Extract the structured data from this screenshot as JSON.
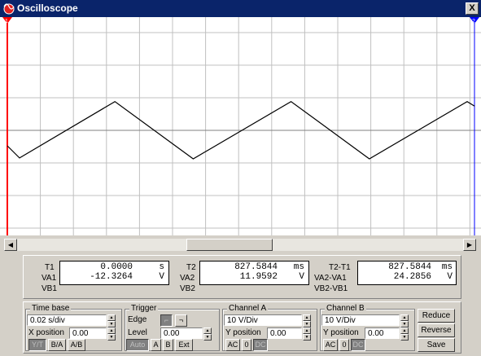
{
  "window": {
    "title": "Oscilloscope",
    "close_label": "X"
  },
  "markers": {
    "t1_label": "1",
    "t2_label": "2"
  },
  "readouts": {
    "t1": {
      "label": "T1",
      "value": "0.0000",
      "unit": "s",
      "va_label": "VA1",
      "va_value": "-12.3264",
      "va_unit": "V",
      "vb_label": "VB1"
    },
    "t2": {
      "label": "T2",
      "value": "827.5844",
      "unit": "ms",
      "va_label": "VA2",
      "va_value": "11.9592",
      "va_unit": "V",
      "vb_label": "VB2"
    },
    "diff": {
      "label": "T2-T1",
      "value": "827.5844",
      "unit": "ms",
      "va_label": "VA2-VA1",
      "va_value": "24.2856",
      "va_unit": "V",
      "vb_label": "VB2-VB1"
    }
  },
  "timebase": {
    "title": "Time base",
    "value": "0.02 s/div",
    "xpos_label": "X position",
    "xpos_value": "0.00",
    "buttons": [
      "Y/T",
      "B/A",
      "A/B"
    ]
  },
  "trigger": {
    "title": "Trigger",
    "edge_label": "Edge",
    "level_label": "Level",
    "level_value": "0.00",
    "buttons": [
      "Auto",
      "A",
      "B",
      "Ext"
    ]
  },
  "channel_a": {
    "title": "Channel A",
    "value": "10 V/Div",
    "ypos_label": "Y position",
    "ypos_value": "0.00",
    "buttons": [
      "AC",
      "0",
      "DC"
    ]
  },
  "channel_b": {
    "title": "Channel B",
    "value": "10 V/Div",
    "ypos_label": "Y position",
    "ypos_value": "0.00",
    "buttons": [
      "AC",
      "0",
      "DC"
    ]
  },
  "actions": {
    "reduce": "Reduce",
    "reverse": "Reverse",
    "save": "Save"
  },
  "colors": {
    "title_bar": "#0a246a",
    "trace": "#000000",
    "grid": "#c0c0c0",
    "cursor1": "#ff0000",
    "cursor2": "#0000ff"
  },
  "waveform": {
    "type": "triangle",
    "peaks_volts": 12,
    "div_volts": 10,
    "sample_points": [
      [
        0,
        -5.1
      ],
      [
        0.5,
        -9.1
      ],
      [
        4.4,
        9.5
      ],
      [
        7.6,
        -9.4
      ],
      [
        11.6,
        9.5
      ],
      [
        14.8,
        -9.4
      ],
      [
        18.8,
        9.5
      ],
      [
        19.1,
        8.0
      ]
    ]
  }
}
